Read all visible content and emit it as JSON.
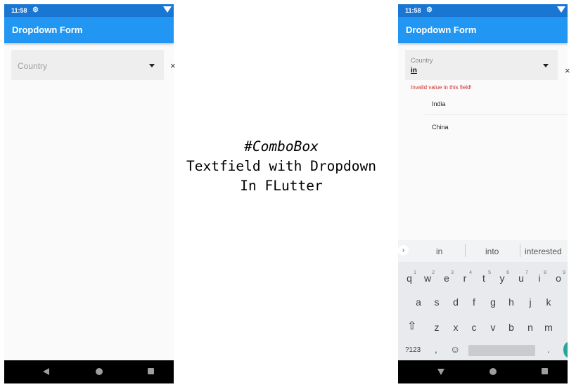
{
  "left_phone": {
    "status_time": "11:58",
    "app_title": "Dropdown Form",
    "country_placeholder": "Country",
    "overflow_glyph": "×"
  },
  "center": {
    "line1": "#ComboBox",
    "line2": "Textfield with Dropdown",
    "line3": "In FLutter"
  },
  "right_phone": {
    "status_time": "11:58",
    "app_title": "Dropdown Form",
    "country_label": "Country",
    "country_value": "in",
    "error_text": "Invalid value in this field!",
    "suggestions": [
      "India",
      "China"
    ],
    "overflow_glyph": "×",
    "keyboard": {
      "word_suggestions": [
        "in",
        "into",
        "interested"
      ],
      "row1": [
        "q",
        "w",
        "e",
        "r",
        "t",
        "y",
        "u",
        "i",
        "o"
      ],
      "row1_hints": [
        "1",
        "2",
        "3",
        "4",
        "5",
        "6",
        "7",
        "8",
        "9"
      ],
      "row2": [
        "a",
        "s",
        "d",
        "f",
        "g",
        "h",
        "j",
        "k"
      ],
      "row3": [
        "z",
        "x",
        "c",
        "v",
        "b",
        "n",
        "m"
      ],
      "symbols_label": "?123",
      "comma": ",",
      "period": "."
    }
  },
  "colors": {
    "status_bar": "#1976d2",
    "app_bar": "#2196f3",
    "error": "#d32f2f",
    "enter_key": "#26a69a"
  }
}
